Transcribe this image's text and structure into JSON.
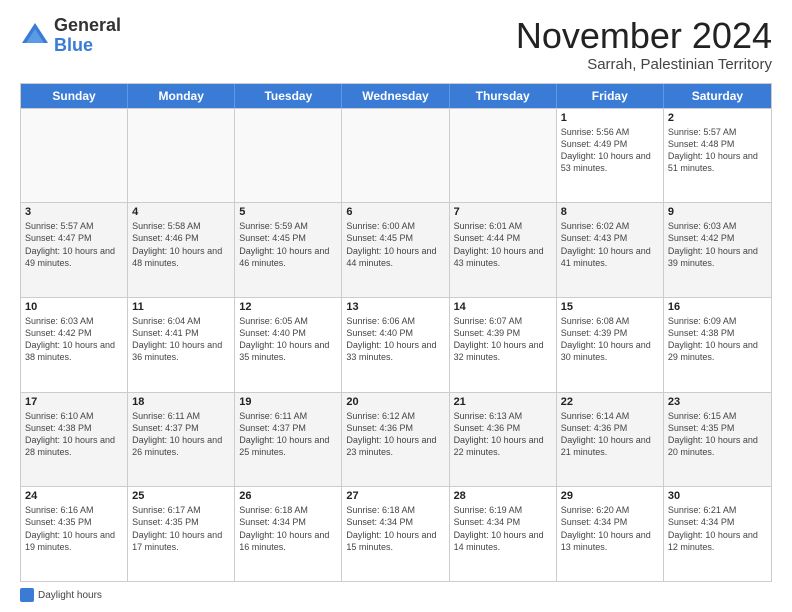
{
  "header": {
    "logo_line1": "General",
    "logo_line2": "Blue",
    "month": "November 2024",
    "location": "Sarrah, Palestinian Territory"
  },
  "days_of_week": [
    "Sunday",
    "Monday",
    "Tuesday",
    "Wednesday",
    "Thursday",
    "Friday",
    "Saturday"
  ],
  "weeks": [
    [
      {
        "day": "",
        "info": ""
      },
      {
        "day": "",
        "info": ""
      },
      {
        "day": "",
        "info": ""
      },
      {
        "day": "",
        "info": ""
      },
      {
        "day": "",
        "info": ""
      },
      {
        "day": "1",
        "info": "Sunrise: 5:56 AM\nSunset: 4:49 PM\nDaylight: 10 hours and 53 minutes."
      },
      {
        "day": "2",
        "info": "Sunrise: 5:57 AM\nSunset: 4:48 PM\nDaylight: 10 hours and 51 minutes."
      }
    ],
    [
      {
        "day": "3",
        "info": "Sunrise: 5:57 AM\nSunset: 4:47 PM\nDaylight: 10 hours and 49 minutes."
      },
      {
        "day": "4",
        "info": "Sunrise: 5:58 AM\nSunset: 4:46 PM\nDaylight: 10 hours and 48 minutes."
      },
      {
        "day": "5",
        "info": "Sunrise: 5:59 AM\nSunset: 4:45 PM\nDaylight: 10 hours and 46 minutes."
      },
      {
        "day": "6",
        "info": "Sunrise: 6:00 AM\nSunset: 4:45 PM\nDaylight: 10 hours and 44 minutes."
      },
      {
        "day": "7",
        "info": "Sunrise: 6:01 AM\nSunset: 4:44 PM\nDaylight: 10 hours and 43 minutes."
      },
      {
        "day": "8",
        "info": "Sunrise: 6:02 AM\nSunset: 4:43 PM\nDaylight: 10 hours and 41 minutes."
      },
      {
        "day": "9",
        "info": "Sunrise: 6:03 AM\nSunset: 4:42 PM\nDaylight: 10 hours and 39 minutes."
      }
    ],
    [
      {
        "day": "10",
        "info": "Sunrise: 6:03 AM\nSunset: 4:42 PM\nDaylight: 10 hours and 38 minutes."
      },
      {
        "day": "11",
        "info": "Sunrise: 6:04 AM\nSunset: 4:41 PM\nDaylight: 10 hours and 36 minutes."
      },
      {
        "day": "12",
        "info": "Sunrise: 6:05 AM\nSunset: 4:40 PM\nDaylight: 10 hours and 35 minutes."
      },
      {
        "day": "13",
        "info": "Sunrise: 6:06 AM\nSunset: 4:40 PM\nDaylight: 10 hours and 33 minutes."
      },
      {
        "day": "14",
        "info": "Sunrise: 6:07 AM\nSunset: 4:39 PM\nDaylight: 10 hours and 32 minutes."
      },
      {
        "day": "15",
        "info": "Sunrise: 6:08 AM\nSunset: 4:39 PM\nDaylight: 10 hours and 30 minutes."
      },
      {
        "day": "16",
        "info": "Sunrise: 6:09 AM\nSunset: 4:38 PM\nDaylight: 10 hours and 29 minutes."
      }
    ],
    [
      {
        "day": "17",
        "info": "Sunrise: 6:10 AM\nSunset: 4:38 PM\nDaylight: 10 hours and 28 minutes."
      },
      {
        "day": "18",
        "info": "Sunrise: 6:11 AM\nSunset: 4:37 PM\nDaylight: 10 hours and 26 minutes."
      },
      {
        "day": "19",
        "info": "Sunrise: 6:11 AM\nSunset: 4:37 PM\nDaylight: 10 hours and 25 minutes."
      },
      {
        "day": "20",
        "info": "Sunrise: 6:12 AM\nSunset: 4:36 PM\nDaylight: 10 hours and 23 minutes."
      },
      {
        "day": "21",
        "info": "Sunrise: 6:13 AM\nSunset: 4:36 PM\nDaylight: 10 hours and 22 minutes."
      },
      {
        "day": "22",
        "info": "Sunrise: 6:14 AM\nSunset: 4:36 PM\nDaylight: 10 hours and 21 minutes."
      },
      {
        "day": "23",
        "info": "Sunrise: 6:15 AM\nSunset: 4:35 PM\nDaylight: 10 hours and 20 minutes."
      }
    ],
    [
      {
        "day": "24",
        "info": "Sunrise: 6:16 AM\nSunset: 4:35 PM\nDaylight: 10 hours and 19 minutes."
      },
      {
        "day": "25",
        "info": "Sunrise: 6:17 AM\nSunset: 4:35 PM\nDaylight: 10 hours and 17 minutes."
      },
      {
        "day": "26",
        "info": "Sunrise: 6:18 AM\nSunset: 4:34 PM\nDaylight: 10 hours and 16 minutes."
      },
      {
        "day": "27",
        "info": "Sunrise: 6:18 AM\nSunset: 4:34 PM\nDaylight: 10 hours and 15 minutes."
      },
      {
        "day": "28",
        "info": "Sunrise: 6:19 AM\nSunset: 4:34 PM\nDaylight: 10 hours and 14 minutes."
      },
      {
        "day": "29",
        "info": "Sunrise: 6:20 AM\nSunset: 4:34 PM\nDaylight: 10 hours and 13 minutes."
      },
      {
        "day": "30",
        "info": "Sunrise: 6:21 AM\nSunset: 4:34 PM\nDaylight: 10 hours and 12 minutes."
      }
    ]
  ],
  "footer": {
    "legend_label": "Daylight hours"
  }
}
